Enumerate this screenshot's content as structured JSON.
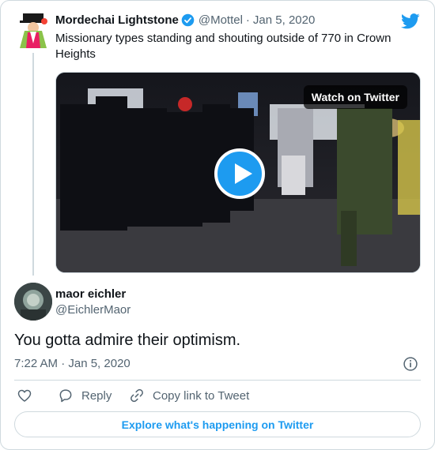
{
  "quoted": {
    "author_name": "Mordechai Lightstone",
    "handle": "@Mottel",
    "date": "Jan 5, 2020",
    "text": "Missionary types standing and shouting outside of 770 in Crown Heights",
    "video_badge": "Watch on Twitter"
  },
  "tweet": {
    "author_name": "maor eichler",
    "handle": "@EichlerMaor",
    "text": "You gotta admire their optimism.",
    "timestamp": "7:22 AM · Jan 5, 2020"
  },
  "actions": {
    "reply_label": "Reply",
    "copy_label": "Copy link to Tweet"
  },
  "explore_label": "Explore what's happening on Twitter",
  "colors": {
    "accent": "#1d9bf0",
    "muted": "#536471",
    "border": "#cfd9de"
  },
  "icons": [
    "bird-logo-icon",
    "verified-badge-icon",
    "play-icon",
    "info-icon",
    "heart-icon",
    "reply-icon",
    "link-icon"
  ]
}
